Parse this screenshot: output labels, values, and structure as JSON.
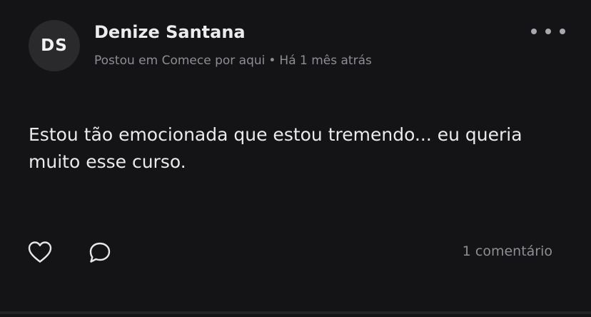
{
  "post": {
    "avatar_initials": "DS",
    "author_name": "Denize Santana",
    "meta": {
      "posted_in": "Postou em Comece por aqui",
      "separator": "•",
      "time_ago": "Há 1 mês atrás"
    },
    "body": "Estou tão emocionada que estou tremendo... eu queria muito esse curso.",
    "actions": {
      "like_icon": "heart-icon",
      "comment_icon": "comment-bubble-icon",
      "more_icon": "more-horizontal-icon",
      "comments_count_label": "1 comentário"
    }
  },
  "colors": {
    "background": "#141416",
    "avatar_bg": "#2a2a2c",
    "primary_text": "#ececec",
    "secondary_text": "#8e8e92"
  }
}
